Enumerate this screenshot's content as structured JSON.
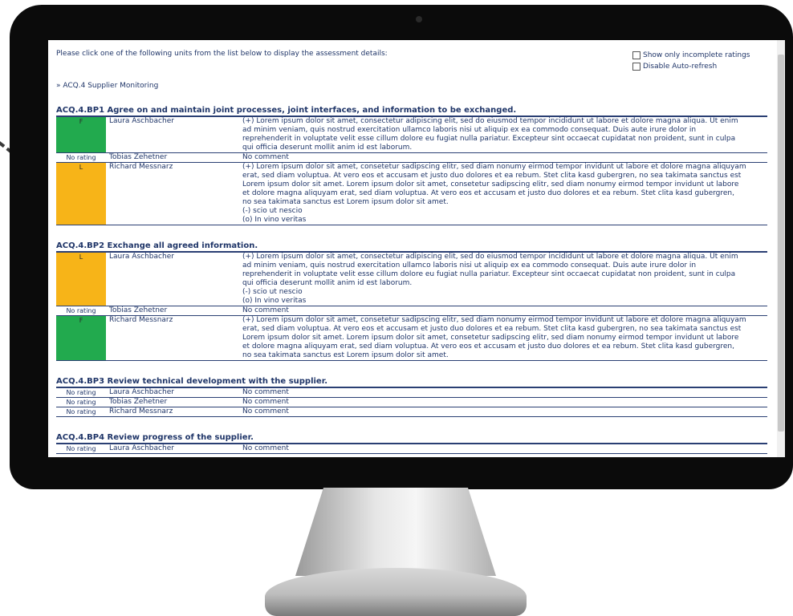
{
  "intro_text": "Please click one of the following units from the list below to display the assessment details:",
  "options": [
    {
      "label": "Show only incomplete ratings",
      "checked": false
    },
    {
      "label": "Disable Auto-refresh",
      "checked": false
    }
  ],
  "breadcrumb": {
    "symbol": "»",
    "label": "ACQ.4 Supplier Monitoring"
  },
  "sections": [
    {
      "title": "ACQ.4.BP1 Agree on and maintain joint processes, joint interfaces, and information to be exchanged.",
      "rows": [
        {
          "rating": "F",
          "rating_class": "F",
          "name": "Laura Aschbacher",
          "comment_lines": [
            "(+) Lorem ipsum dolor sit amet, consectetur adipiscing elit, sed do eiusmod tempor incididunt ut labore et dolore magna aliqua. Ut enim",
            "ad minim veniam, quis nostrud exercitation ullamco laboris nisi ut aliquip ex ea commodo consequat. Duis aute irure dolor in",
            "reprehenderit in voluptate velit esse cillum dolore eu fugiat nulla pariatur. Excepteur sint occaecat cupidatat non proident, sunt in culpa",
            "qui officia deserunt mollit anim id est laborum."
          ]
        },
        {
          "rating": "No rating",
          "rating_class": "none",
          "name": "Tobias Zehetner",
          "comment_lines": [
            "No comment"
          ]
        },
        {
          "rating": "L",
          "rating_class": "L",
          "name": "Richard Messnarz",
          "comment_lines": [
            "(+) Lorem ipsum dolor sit amet, consetetur sadipscing elitr, sed diam nonumy eirmod tempor invidunt ut labore et dolore magna aliquyam",
            "erat, sed diam voluptua. At vero eos et accusam et justo duo dolores et ea rebum. Stet clita kasd gubergren, no sea takimata sanctus est",
            "Lorem ipsum dolor sit amet. Lorem ipsum dolor sit amet, consetetur sadipscing elitr, sed diam nonumy eirmod tempor invidunt ut labore",
            "et dolore magna aliquyam erat, sed diam voluptua. At vero eos et accusam et justo duo dolores et ea rebum. Stet clita kasd gubergren,",
            "no sea takimata sanctus est Lorem ipsum dolor sit amet.",
            "(-) scio ut nescio",
            "(o) In vino veritas"
          ]
        }
      ]
    },
    {
      "title": "ACQ.4.BP2 Exchange all agreed information.",
      "rows": [
        {
          "rating": "L",
          "rating_class": "L",
          "name": "Laura Aschbacher",
          "comment_lines": [
            "(+) Lorem ipsum dolor sit amet, consectetur adipiscing elit, sed do eiusmod tempor incididunt ut labore et dolore magna aliqua. Ut enim",
            "ad minim veniam, quis nostrud exercitation ullamco laboris nisi ut aliquip ex ea commodo consequat. Duis aute irure dolor in",
            "reprehenderit in voluptate velit esse cillum dolore eu fugiat nulla pariatur. Excepteur sint occaecat cupidatat non proident, sunt in culpa",
            "qui officia deserunt mollit anim id est laborum.",
            "(-) scio ut nescio",
            "(o) In vino veritas"
          ]
        },
        {
          "rating": "No rating",
          "rating_class": "none",
          "name": "Tobias Zehetner",
          "comment_lines": [
            "No comment"
          ]
        },
        {
          "rating": "F",
          "rating_class": "F",
          "name": "Richard Messnarz",
          "comment_lines": [
            "(+) Lorem ipsum dolor sit amet, consetetur sadipscing elitr, sed diam nonumy eirmod tempor invidunt ut labore et dolore magna aliquyam",
            "erat, sed diam voluptua. At vero eos et accusam et justo duo dolores et ea rebum. Stet clita kasd gubergren, no sea takimata sanctus est",
            "Lorem ipsum dolor sit amet. Lorem ipsum dolor sit amet, consetetur sadipscing elitr, sed diam nonumy eirmod tempor invidunt ut labore",
            "et dolore magna aliquyam erat, sed diam voluptua. At vero eos et accusam et justo duo dolores et ea rebum. Stet clita kasd gubergren,",
            "no sea takimata sanctus est Lorem ipsum dolor sit amet."
          ]
        }
      ]
    },
    {
      "title": "ACQ.4.BP3 Review technical development with the supplier.",
      "rows": [
        {
          "rating": "No rating",
          "rating_class": "none",
          "name": "Laura Aschbacher",
          "comment_lines": [
            "No comment"
          ]
        },
        {
          "rating": "No rating",
          "rating_class": "none",
          "name": "Tobias Zehetner",
          "comment_lines": [
            "No comment"
          ]
        },
        {
          "rating": "No rating",
          "rating_class": "none",
          "name": "Richard Messnarz",
          "comment_lines": [
            "No comment"
          ]
        }
      ]
    },
    {
      "title": "ACQ.4.BP4 Review progress of the supplier.",
      "rows": [
        {
          "rating": "No rating",
          "rating_class": "none",
          "name": "Laura Aschbacher",
          "comment_lines": [
            "No comment"
          ]
        }
      ]
    }
  ],
  "colors": {
    "fully": "#22aa4e",
    "largely": "#f7b418",
    "text": "#1f3568"
  }
}
